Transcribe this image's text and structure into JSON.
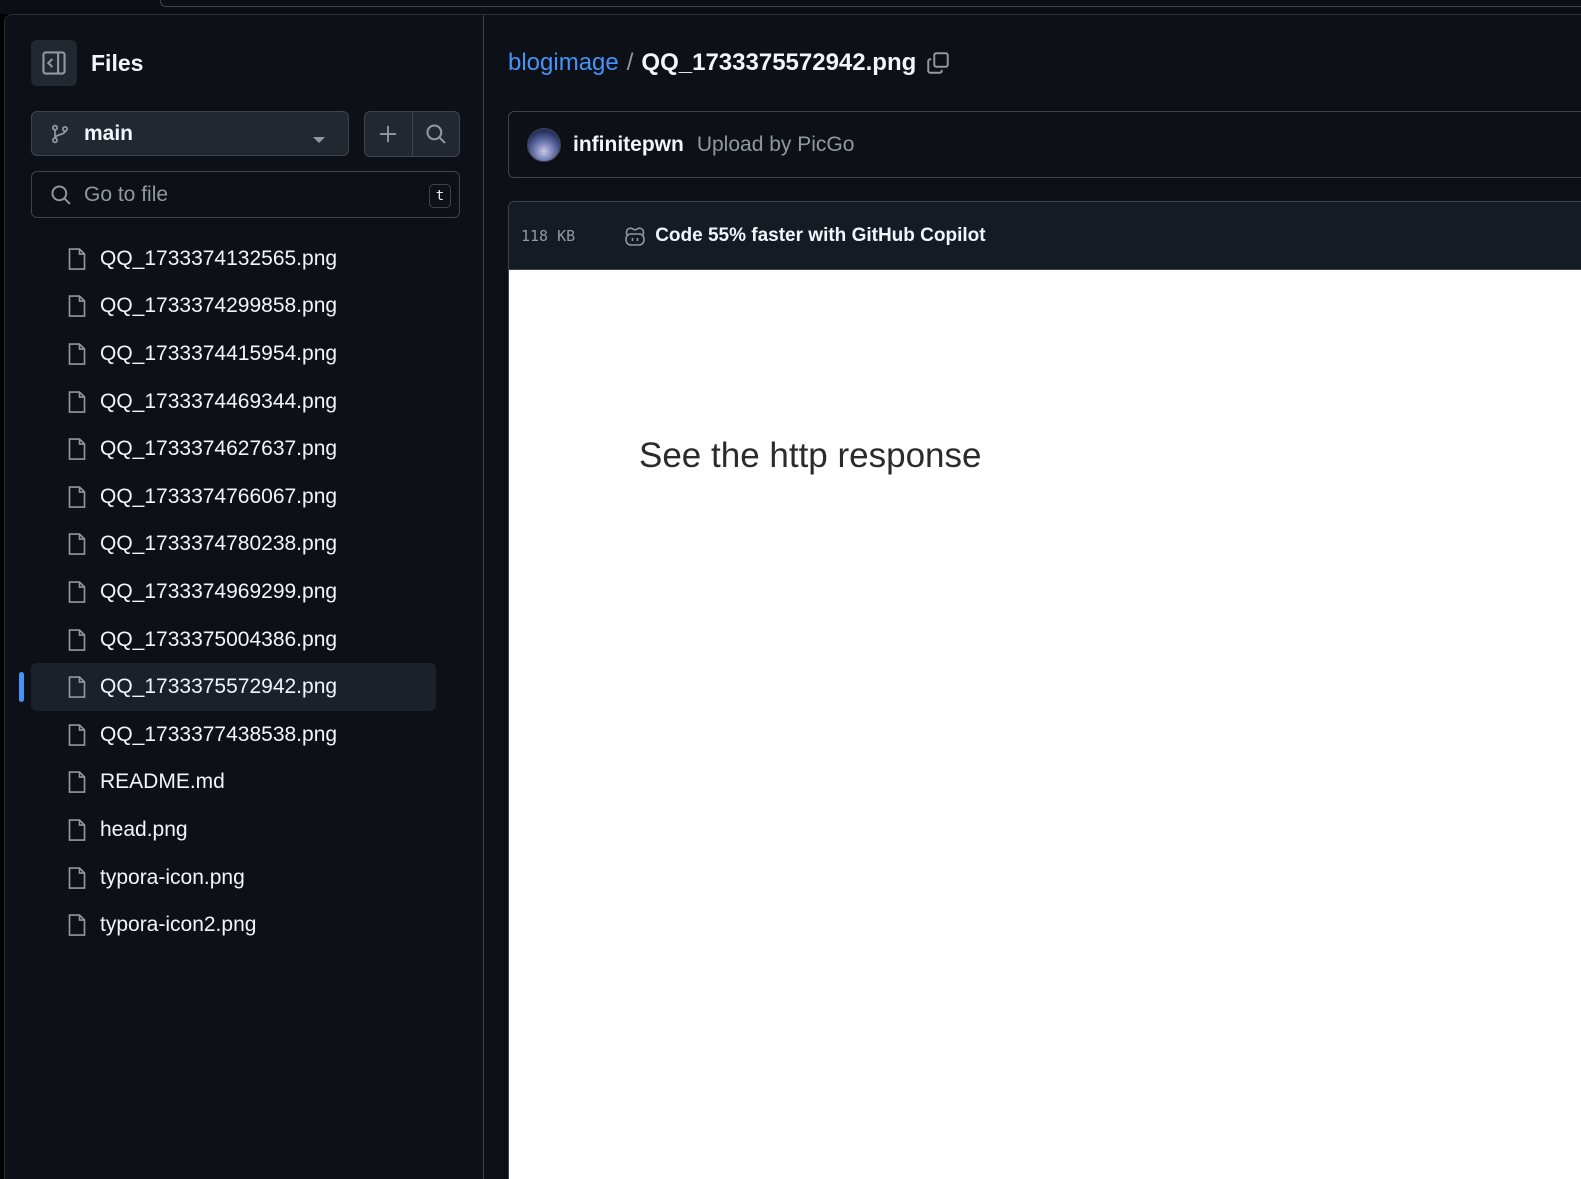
{
  "sidebar": {
    "title": "Files",
    "branch": "main",
    "search_placeholder": "Go to file",
    "search_shortcut": "t",
    "files": [
      {
        "name": "QQ_1733374132565.png",
        "selected": false
      },
      {
        "name": "QQ_1733374299858.png",
        "selected": false
      },
      {
        "name": "QQ_1733374415954.png",
        "selected": false
      },
      {
        "name": "QQ_1733374469344.png",
        "selected": false
      },
      {
        "name": "QQ_1733374627637.png",
        "selected": false
      },
      {
        "name": "QQ_1733374766067.png",
        "selected": false
      },
      {
        "name": "QQ_1733374780238.png",
        "selected": false
      },
      {
        "name": "QQ_1733374969299.png",
        "selected": false
      },
      {
        "name": "QQ_1733375004386.png",
        "selected": false
      },
      {
        "name": "QQ_1733375572942.png",
        "selected": true
      },
      {
        "name": "QQ_1733377438538.png",
        "selected": false
      },
      {
        "name": "README.md",
        "selected": false
      },
      {
        "name": "head.png",
        "selected": false
      },
      {
        "name": "typora-icon.png",
        "selected": false
      },
      {
        "name": "typora-icon2.png",
        "selected": false
      }
    ]
  },
  "breadcrumb": {
    "repo": "blogimage",
    "separator": "/",
    "file": "QQ_1733375572942.png"
  },
  "commit": {
    "user": "infinitepwn",
    "message": "Upload by PicGo"
  },
  "file_header": {
    "size": "118 KB",
    "copilot_text": "Code 55% faster with GitHub Copilot"
  },
  "preview": {
    "text": "See the http response"
  },
  "colors": {
    "accent": "#4493f8",
    "background": "#0d1117",
    "border": "#3d444d"
  }
}
